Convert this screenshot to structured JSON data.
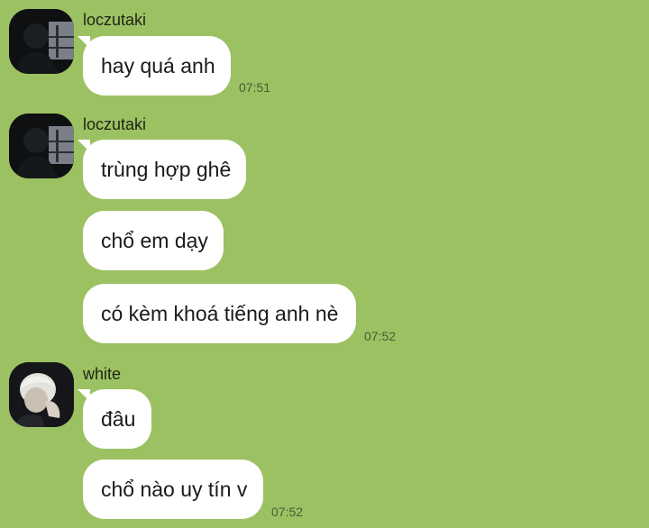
{
  "messages": [
    {
      "sender": "loczutaki",
      "bubbles": [
        "hay quá anh"
      ],
      "time": "07:51"
    },
    {
      "sender": "loczutaki",
      "bubbles": [
        "trùng hợp ghê",
        "chổ em dạy",
        "có kèm khoá tiếng anh nè"
      ],
      "time": "07:52"
    },
    {
      "sender": "white",
      "bubbles": [
        "đâu",
        "chổ nào uy tín v"
      ],
      "time": "07:52"
    }
  ],
  "icons": {
    "avatar_loczutaki": "user-avatar-icon",
    "avatar_white": "user-avatar-icon"
  },
  "colors": {
    "background": "#9cc162",
    "bubble": "#ffffff"
  }
}
